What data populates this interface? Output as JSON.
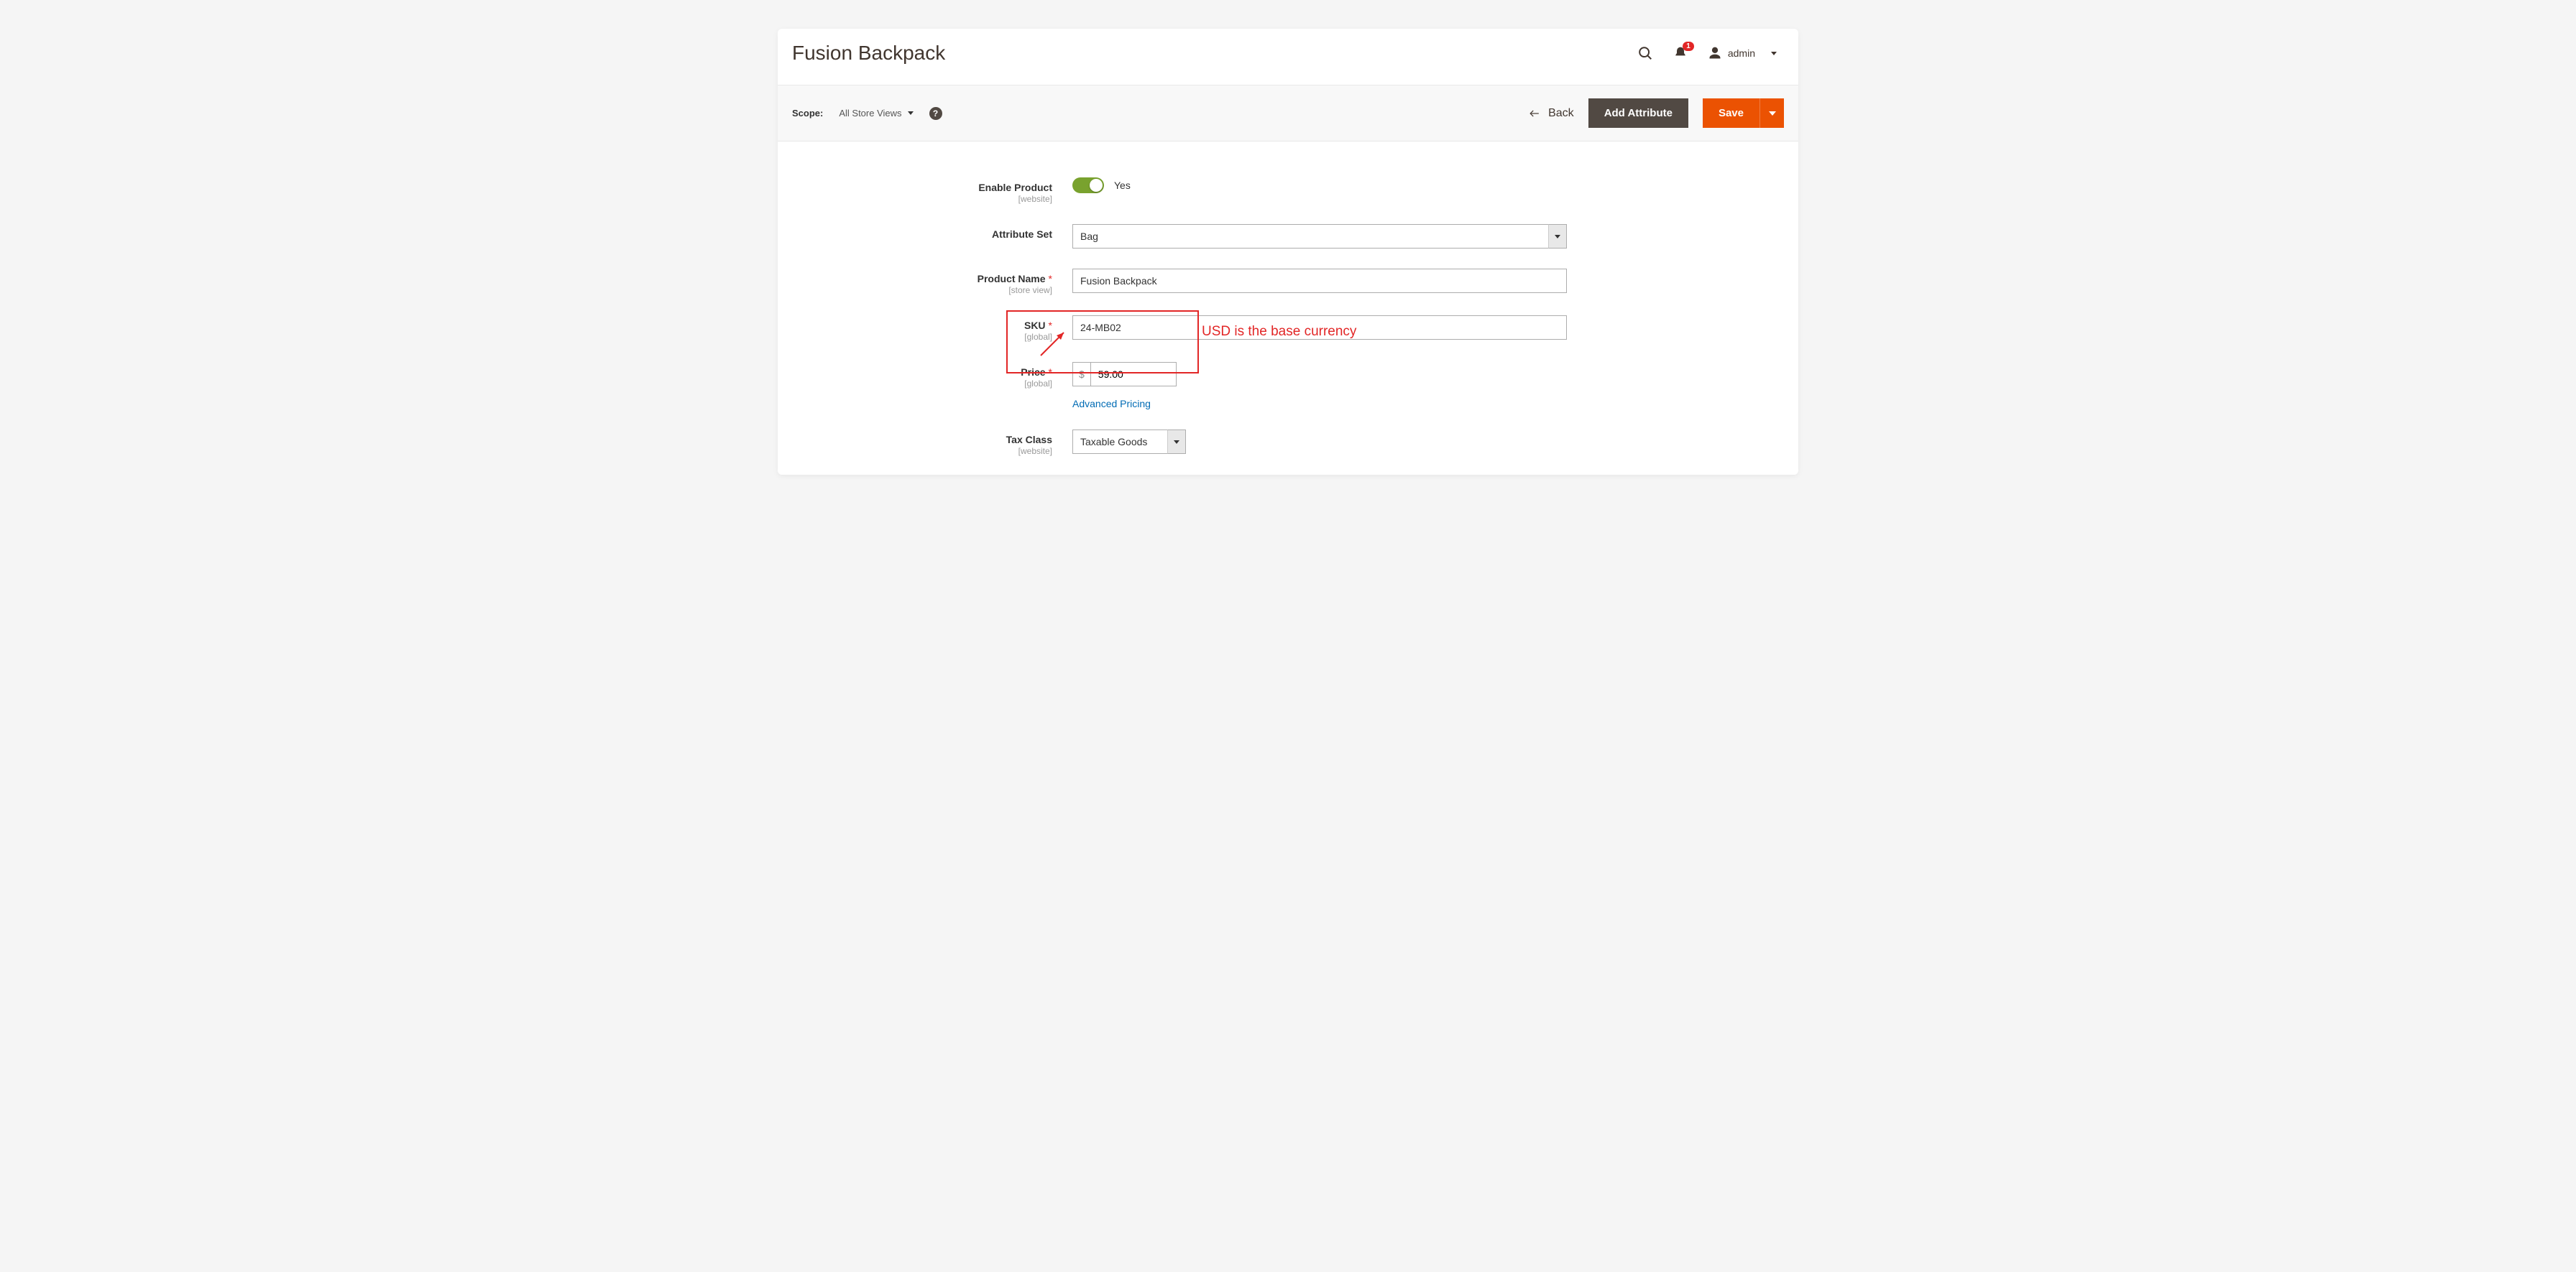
{
  "header": {
    "title": "Fusion Backpack",
    "notification_count": "1",
    "user": "admin"
  },
  "toolbar": {
    "scope_label": "Scope:",
    "scope_value": "All Store Views",
    "back_label": "Back",
    "add_attribute_label": "Add Attribute",
    "save_label": "Save"
  },
  "form": {
    "enable_product": {
      "label": "Enable Product",
      "scope": "[website]",
      "value_text": "Yes"
    },
    "attribute_set": {
      "label": "Attribute Set",
      "value": "Bag"
    },
    "product_name": {
      "label": "Product Name",
      "scope": "[store view]",
      "value": "Fusion Backpack"
    },
    "sku": {
      "label": "SKU",
      "scope": "[global]",
      "value": "24-MB02"
    },
    "price": {
      "label": "Price",
      "scope": "[global]",
      "currency": "$",
      "value": "59.00",
      "advanced_link": "Advanced Pricing"
    },
    "tax_class": {
      "label": "Tax Class",
      "scope": "[website]",
      "value": "Taxable Goods"
    }
  },
  "annotation": {
    "text": "USD is the base currency"
  }
}
